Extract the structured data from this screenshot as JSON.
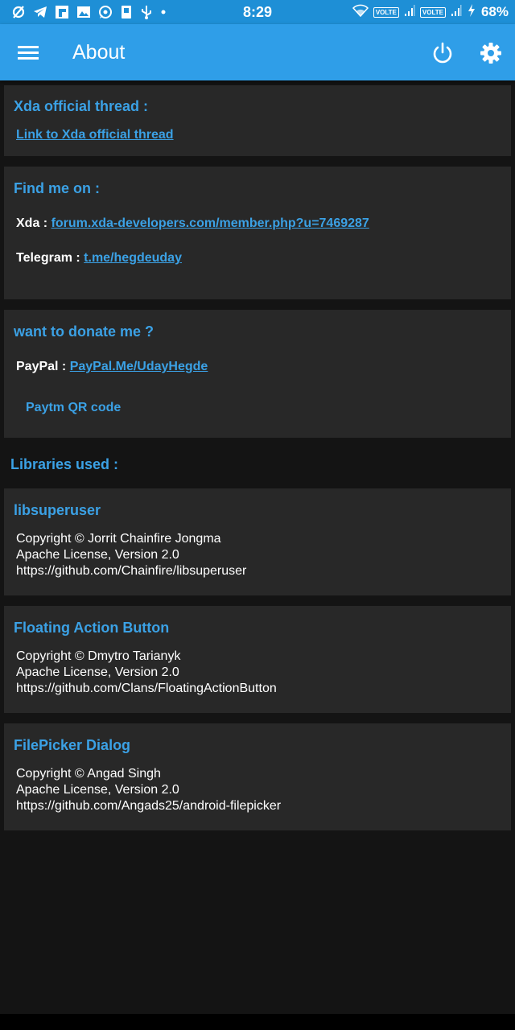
{
  "status_bar": {
    "time": "8:29",
    "volte_1": "VOLTE",
    "volte_2": "VOLTE",
    "battery": "68%",
    "left_icons": [
      "no-sim-icon",
      "telegram-icon",
      "flipboard-icon",
      "gallery-icon",
      "whatsapp-icon",
      "sd-card-icon",
      "usb-icon",
      "dot-icon"
    ]
  },
  "appbar": {
    "title": "About"
  },
  "xda_card": {
    "title": "Xda official thread :",
    "link": "Link to Xda official thread"
  },
  "find_card": {
    "title": "Find me on :",
    "xda_label": "Xda : ",
    "xda_link": "forum.xda-developers.com/member.php?u=7469287",
    "telegram_label": "Telegram : ",
    "telegram_link": "t.me/hegdeuday"
  },
  "donate_card": {
    "title": "want to donate me ?",
    "paypal_label": "PayPal : ",
    "paypal_link": "PayPal.Me/UdayHegde",
    "paytm_button": "Paytm QR code"
  },
  "libraries": {
    "section_title": "Libraries used :",
    "items": [
      {
        "name": "libsuperuser",
        "copyright": "Copyright © Jorrit Chainfire Jongma",
        "license": "Apache License, Version 2.0",
        "url": "https://github.com/Chainfire/libsuperuser"
      },
      {
        "name": "Floating Action Button",
        "copyright": "Copyright © Dmytro Tarianyk",
        "license": "Apache License, Version 2.0",
        "url": "https://github.com/Clans/FloatingActionButton"
      },
      {
        "name": "FilePicker Dialog",
        "copyright": "Copyright © Angad Singh",
        "license": "Apache License, Version 2.0",
        "url": "https://github.com/Angads25/android-filepicker"
      }
    ]
  },
  "colors": {
    "status_bar": "#1e8fd6",
    "app_bar": "#2f9ee8",
    "accent": "#3ba1e5",
    "card": "#282828",
    "background": "#141414"
  }
}
